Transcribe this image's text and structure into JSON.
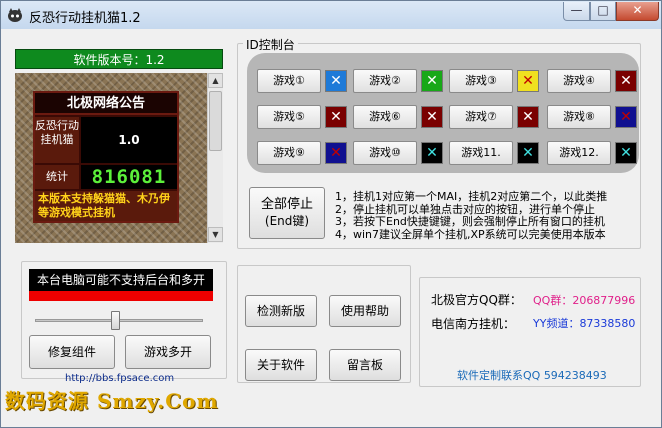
{
  "window": {
    "title": "反恐行动挂机猫1.2",
    "min_glyph": "—",
    "max_glyph": "□",
    "close_glyph": "✕"
  },
  "left": {
    "version_label": "软件版本号：1.2",
    "notice": {
      "title": "北极网络公告",
      "app_label": "反恐行动挂机猫",
      "app_value": "1.0",
      "stats_label": "统计",
      "stats_value": "816081",
      "message": "本版本支持躲猫猫、木乃伊等游戏模式挂机"
    }
  },
  "control": {
    "legend": "ID控制台",
    "games": [
      {
        "label": "游戏①",
        "color": "#1e7ad8",
        "x_color": "#ffffff"
      },
      {
        "label": "游戏②",
        "color": "#18a818",
        "x_color": "#ffffff"
      },
      {
        "label": "游戏③",
        "color": "#f0e020",
        "x_color": "#c00000"
      },
      {
        "label": "游戏④",
        "color": "#7a0000",
        "x_color": "#ffffff"
      },
      {
        "label": "游戏⑤",
        "color": "#7a0000",
        "x_color": "#ffffff"
      },
      {
        "label": "游戏⑥",
        "color": "#7a0000",
        "x_color": "#ffffff"
      },
      {
        "label": "游戏⑦",
        "color": "#7a0000",
        "x_color": "#ffffff"
      },
      {
        "label": "游戏⑧",
        "color": "#101090",
        "x_color": "#c00000"
      },
      {
        "label": "游戏⑨",
        "color": "#101090",
        "x_color": "#c00000"
      },
      {
        "label": "游戏⑩",
        "color": "#000000",
        "x_color": "#40e0e0"
      },
      {
        "label": "游戏11.",
        "color": "#000000",
        "x_color": "#40e0e0"
      },
      {
        "label": "游戏12.",
        "color": "#000000",
        "x_color": "#40e0e0"
      }
    ],
    "stop_label_1": "全部停止",
    "stop_label_2": "(End键)",
    "instructions": [
      "1，挂机1对应第一个MAI，挂机2对应第二个，以此类推",
      "2，停止挂机可以单独点击对应的按钮，进行单个停止",
      "3，若按下End快捷键键，则会强制停止所有窗口的挂机",
      "4，win7建议全屏单个挂机,XP系统可以完美使用本版本"
    ]
  },
  "bottom_left": {
    "warning": "本台电脑可能不支持后台和多开",
    "slider_level": 0.48,
    "repair_button": "修复组件",
    "multi_button": "游戏多开",
    "link": "http://bbs.fpsace.com"
  },
  "bottom_middle": {
    "check_update": "检测新版",
    "help": "使用帮助",
    "about": "关于软件",
    "message_board": "留言板"
  },
  "bottom_right": {
    "qq_group_label": "北极官方QQ群：",
    "qq_group_value": "QQ群：206877996",
    "yy_label": "电信南方挂机：",
    "yy_value": "YY频道：87338580",
    "custom_contact": "软件定制联系QQ 594238493",
    "colors": {
      "qq": "#e0208a",
      "yy": "#1a3ad8",
      "contact": "#1a6ab8"
    }
  },
  "watermark": "数码资源 Smzy.Com"
}
